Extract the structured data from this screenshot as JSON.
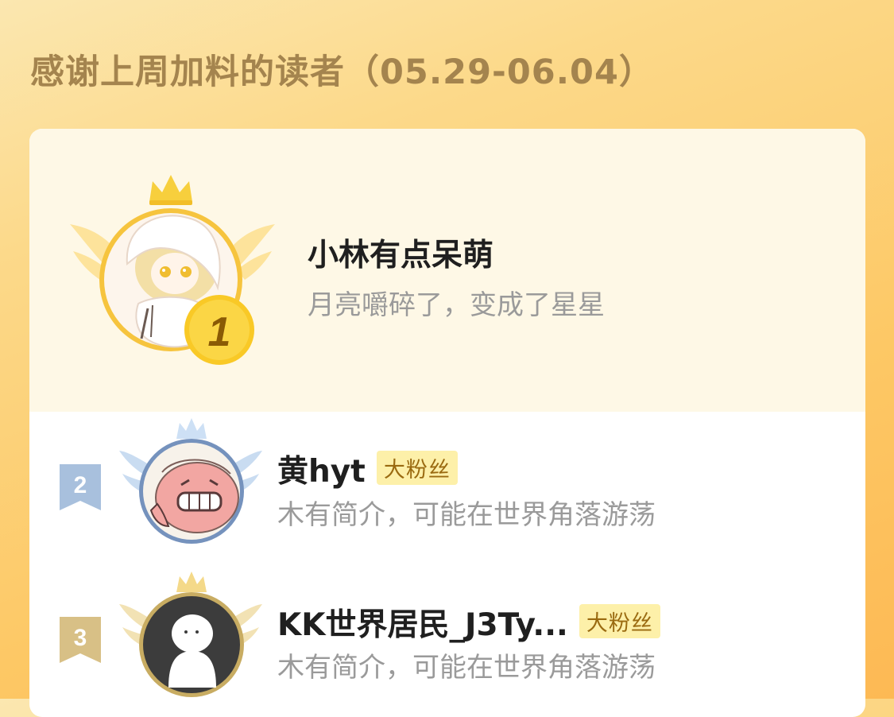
{
  "header": {
    "title": "感谢上周加料的读者（05.29-06.04）"
  },
  "readers": [
    {
      "rank": "1",
      "name": "小林有点呆萌",
      "bio": "月亮嚼碎了，变成了星星",
      "badge": ""
    },
    {
      "rank": "2",
      "name": "黄hyt",
      "bio": "木有简介，可能在世界角落游荡",
      "badge": "大粉丝"
    },
    {
      "rank": "3",
      "name": "KK世界居民_J3Ty...",
      "bio": "木有简介，可能在世界角落游荡",
      "badge": "大粉丝"
    }
  ],
  "colors": {
    "gold": "#f6b41d",
    "silver": "#9dbbe1",
    "bronze": "#d8bd7c",
    "badge_bg": "#fdf0a9"
  },
  "icons": {
    "rank1_frame": "gold-crown-wings-icon",
    "rank2_frame": "silver-crown-wings-icon",
    "rank3_frame": "gold-crown-wings-icon",
    "rank1_medal": "gold-medal-icon",
    "rank2_tag": "ribbon-tag-icon",
    "rank3_tag": "ribbon-tag-icon"
  }
}
